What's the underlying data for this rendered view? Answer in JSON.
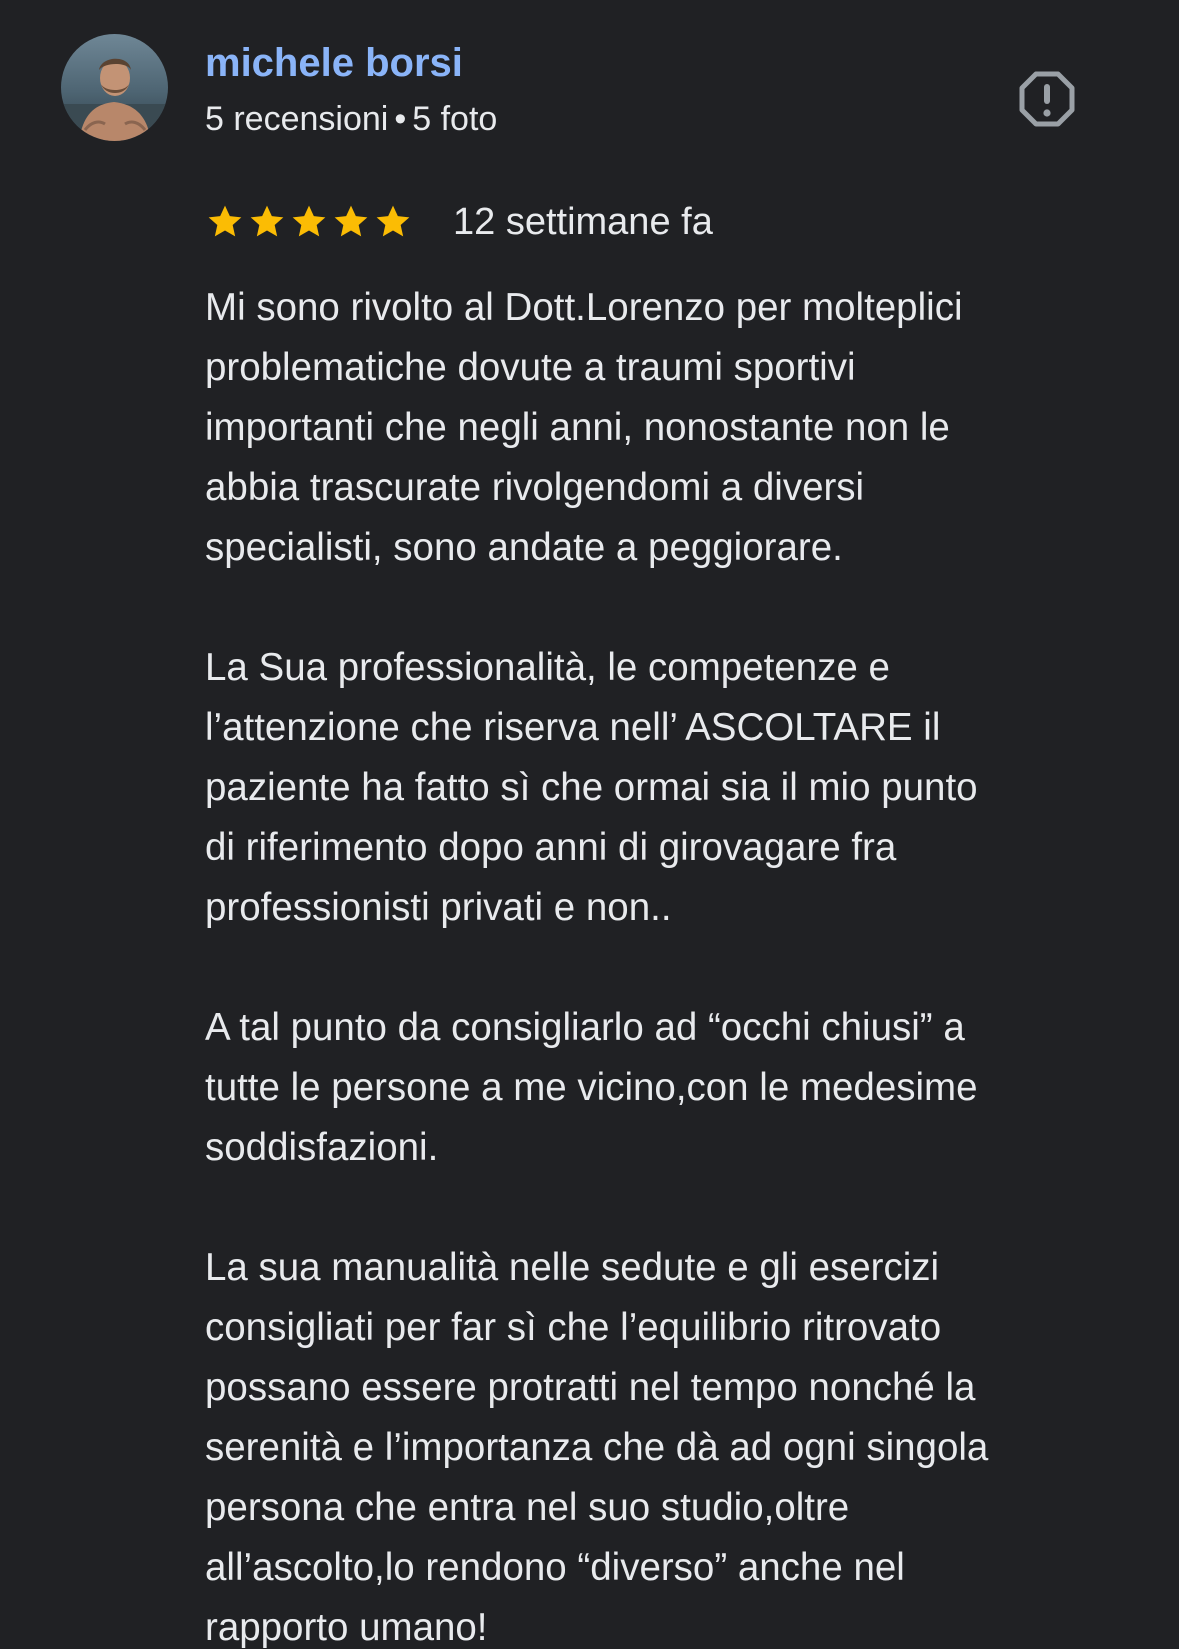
{
  "author": {
    "name": "michele borsi",
    "reviews_count": "5 recensioni",
    "separator": "•",
    "photos_count": "5 foto",
    "avatar_icon": "user-avatar-photo"
  },
  "report": {
    "icon": "report-flag-icon"
  },
  "rating": {
    "stars": 5,
    "max_stars": 5,
    "star_color": "#fbbc04",
    "time_ago": "12 settimane fa"
  },
  "review": {
    "paragraphs": [
      [
        "Mi sono rivolto al Dott.Lorenzo per molteplici",
        "problematiche dovute a traumi sportivi",
        "importanti che negli anni, nonostante non le",
        "abbia trascurate rivolgendomi a diversi",
        "specialisti, sono andate a peggiorare."
      ],
      [
        "La Sua professionalità, le competenze e",
        "l’attenzione che riserva nell’ ASCOLTARE il",
        "paziente ha fatto sì che ormai sia il mio punto",
        "di riferimento dopo anni di girovagare fra",
        "professionisti privati e non.."
      ],
      [
        "A tal punto da consigliarlo ad “occhi chiusi” a",
        "tutte le persone a me vicino,con le medesime",
        "soddisfazioni."
      ],
      [
        "La sua manualità nelle sedute e gli esercizi",
        "consigliati per far sì che l’equilibrio ritrovato",
        "possano essere protratti nel tempo nonché la",
        "serenità e l’importanza che dà ad ogni singola",
        "persona che entra nel suo studio,oltre",
        "all’ascolto,lo rendono “diverso” anche nel",
        "rapporto umano!"
      ]
    ]
  },
  "colors": {
    "background": "#202124",
    "name_link": "#8ab4f8",
    "text": "#e8eaed",
    "icon": "#9aa0a6"
  }
}
